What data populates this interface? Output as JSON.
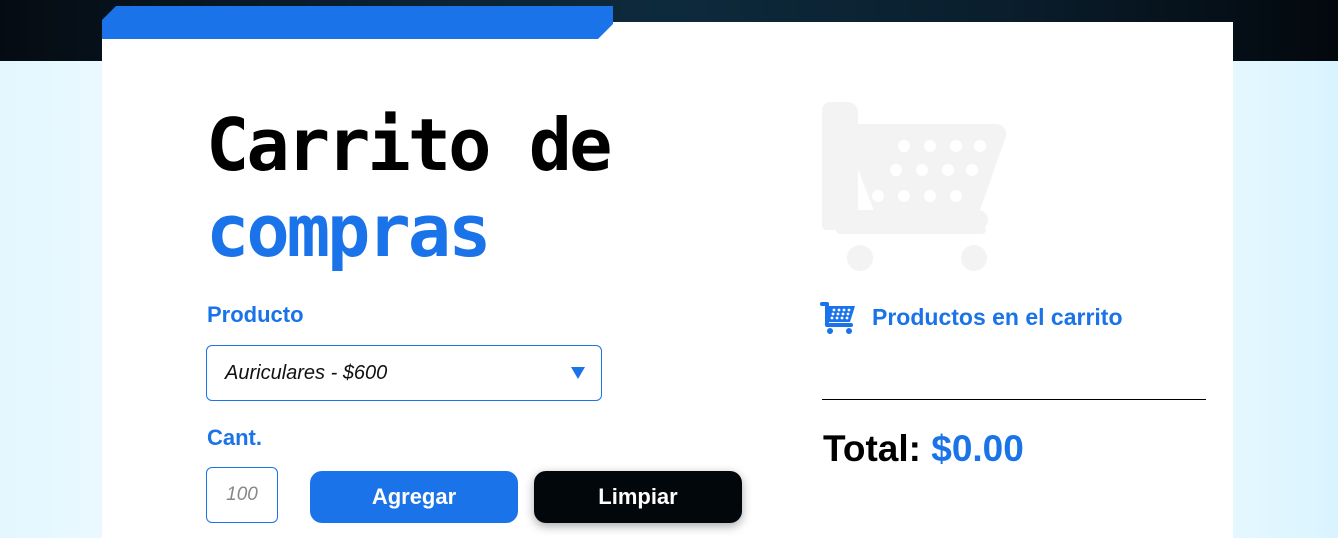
{
  "title": {
    "line1": "Carrito de",
    "line2": "compras"
  },
  "form": {
    "product_label": "Producto",
    "product_selected": "Auriculares - $600",
    "qty_label": "Cant.",
    "qty_placeholder": "100",
    "add_button": "Agregar",
    "clear_button": "Limpiar"
  },
  "cart": {
    "heading": "Productos en el carrito",
    "total_label": "Total:",
    "total_value": "$0.00"
  },
  "icons": {
    "hero": "shopping-cart-icon",
    "heading": "shopping-cart-icon"
  },
  "colors": {
    "accent": "#1a73e8",
    "dark": "#02070c",
    "ghost_cart": "#f3f3f3"
  }
}
